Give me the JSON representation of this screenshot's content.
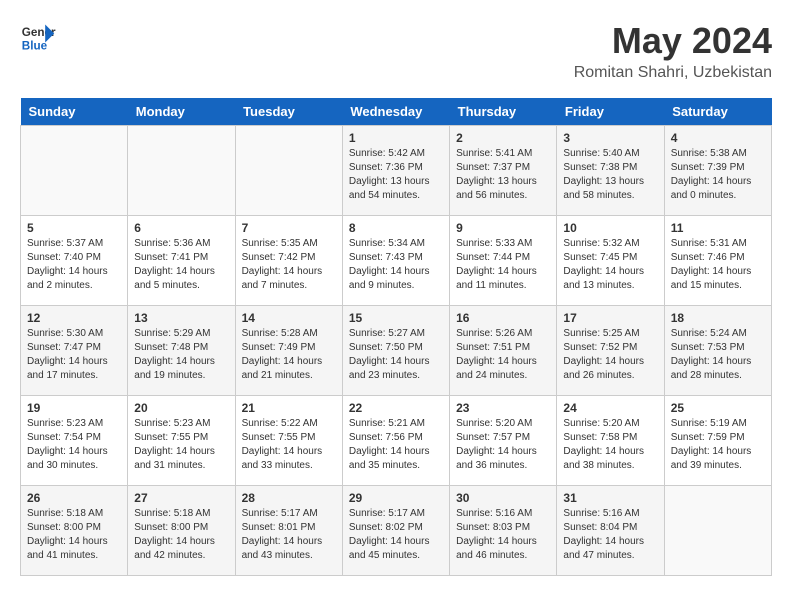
{
  "header": {
    "logo_line1": "General",
    "logo_line2": "Blue",
    "month_title": "May 2024",
    "location": "Romitan Shahri, Uzbekistan"
  },
  "days_of_week": [
    "Sunday",
    "Monday",
    "Tuesday",
    "Wednesday",
    "Thursday",
    "Friday",
    "Saturday"
  ],
  "weeks": [
    [
      {
        "num": "",
        "info": ""
      },
      {
        "num": "",
        "info": ""
      },
      {
        "num": "",
        "info": ""
      },
      {
        "num": "1",
        "info": "Sunrise: 5:42 AM\nSunset: 7:36 PM\nDaylight: 13 hours\nand 54 minutes."
      },
      {
        "num": "2",
        "info": "Sunrise: 5:41 AM\nSunset: 7:37 PM\nDaylight: 13 hours\nand 56 minutes."
      },
      {
        "num": "3",
        "info": "Sunrise: 5:40 AM\nSunset: 7:38 PM\nDaylight: 13 hours\nand 58 minutes."
      },
      {
        "num": "4",
        "info": "Sunrise: 5:38 AM\nSunset: 7:39 PM\nDaylight: 14 hours\nand 0 minutes."
      }
    ],
    [
      {
        "num": "5",
        "info": "Sunrise: 5:37 AM\nSunset: 7:40 PM\nDaylight: 14 hours\nand 2 minutes."
      },
      {
        "num": "6",
        "info": "Sunrise: 5:36 AM\nSunset: 7:41 PM\nDaylight: 14 hours\nand 5 minutes."
      },
      {
        "num": "7",
        "info": "Sunrise: 5:35 AM\nSunset: 7:42 PM\nDaylight: 14 hours\nand 7 minutes."
      },
      {
        "num": "8",
        "info": "Sunrise: 5:34 AM\nSunset: 7:43 PM\nDaylight: 14 hours\nand 9 minutes."
      },
      {
        "num": "9",
        "info": "Sunrise: 5:33 AM\nSunset: 7:44 PM\nDaylight: 14 hours\nand 11 minutes."
      },
      {
        "num": "10",
        "info": "Sunrise: 5:32 AM\nSunset: 7:45 PM\nDaylight: 14 hours\nand 13 minutes."
      },
      {
        "num": "11",
        "info": "Sunrise: 5:31 AM\nSunset: 7:46 PM\nDaylight: 14 hours\nand 15 minutes."
      }
    ],
    [
      {
        "num": "12",
        "info": "Sunrise: 5:30 AM\nSunset: 7:47 PM\nDaylight: 14 hours\nand 17 minutes."
      },
      {
        "num": "13",
        "info": "Sunrise: 5:29 AM\nSunset: 7:48 PM\nDaylight: 14 hours\nand 19 minutes."
      },
      {
        "num": "14",
        "info": "Sunrise: 5:28 AM\nSunset: 7:49 PM\nDaylight: 14 hours\nand 21 minutes."
      },
      {
        "num": "15",
        "info": "Sunrise: 5:27 AM\nSunset: 7:50 PM\nDaylight: 14 hours\nand 23 minutes."
      },
      {
        "num": "16",
        "info": "Sunrise: 5:26 AM\nSunset: 7:51 PM\nDaylight: 14 hours\nand 24 minutes."
      },
      {
        "num": "17",
        "info": "Sunrise: 5:25 AM\nSunset: 7:52 PM\nDaylight: 14 hours\nand 26 minutes."
      },
      {
        "num": "18",
        "info": "Sunrise: 5:24 AM\nSunset: 7:53 PM\nDaylight: 14 hours\nand 28 minutes."
      }
    ],
    [
      {
        "num": "19",
        "info": "Sunrise: 5:23 AM\nSunset: 7:54 PM\nDaylight: 14 hours\nand 30 minutes."
      },
      {
        "num": "20",
        "info": "Sunrise: 5:23 AM\nSunset: 7:55 PM\nDaylight: 14 hours\nand 31 minutes."
      },
      {
        "num": "21",
        "info": "Sunrise: 5:22 AM\nSunset: 7:55 PM\nDaylight: 14 hours\nand 33 minutes."
      },
      {
        "num": "22",
        "info": "Sunrise: 5:21 AM\nSunset: 7:56 PM\nDaylight: 14 hours\nand 35 minutes."
      },
      {
        "num": "23",
        "info": "Sunrise: 5:20 AM\nSunset: 7:57 PM\nDaylight: 14 hours\nand 36 minutes."
      },
      {
        "num": "24",
        "info": "Sunrise: 5:20 AM\nSunset: 7:58 PM\nDaylight: 14 hours\nand 38 minutes."
      },
      {
        "num": "25",
        "info": "Sunrise: 5:19 AM\nSunset: 7:59 PM\nDaylight: 14 hours\nand 39 minutes."
      }
    ],
    [
      {
        "num": "26",
        "info": "Sunrise: 5:18 AM\nSunset: 8:00 PM\nDaylight: 14 hours\nand 41 minutes."
      },
      {
        "num": "27",
        "info": "Sunrise: 5:18 AM\nSunset: 8:00 PM\nDaylight: 14 hours\nand 42 minutes."
      },
      {
        "num": "28",
        "info": "Sunrise: 5:17 AM\nSunset: 8:01 PM\nDaylight: 14 hours\nand 43 minutes."
      },
      {
        "num": "29",
        "info": "Sunrise: 5:17 AM\nSunset: 8:02 PM\nDaylight: 14 hours\nand 45 minutes."
      },
      {
        "num": "30",
        "info": "Sunrise: 5:16 AM\nSunset: 8:03 PM\nDaylight: 14 hours\nand 46 minutes."
      },
      {
        "num": "31",
        "info": "Sunrise: 5:16 AM\nSunset: 8:04 PM\nDaylight: 14 hours\nand 47 minutes."
      },
      {
        "num": "",
        "info": ""
      }
    ]
  ]
}
